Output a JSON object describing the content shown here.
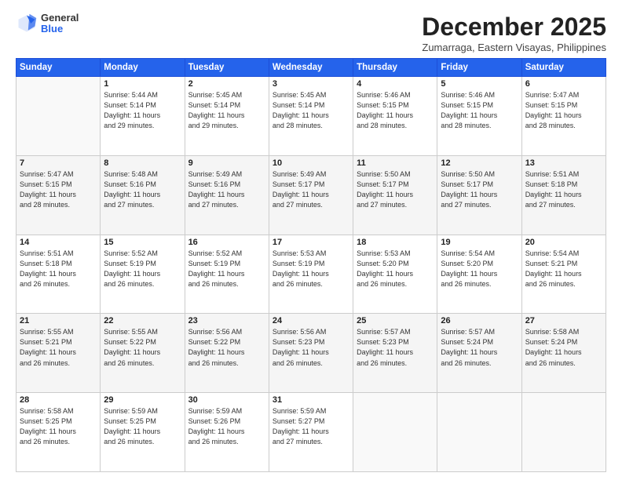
{
  "logo": {
    "general": "General",
    "blue": "Blue"
  },
  "header": {
    "month": "December 2025",
    "location": "Zumarraga, Eastern Visayas, Philippines"
  },
  "weekdays": [
    "Sunday",
    "Monday",
    "Tuesday",
    "Wednesday",
    "Thursday",
    "Friday",
    "Saturday"
  ],
  "weeks": [
    [
      {
        "day": "",
        "info": ""
      },
      {
        "day": "1",
        "info": "Sunrise: 5:44 AM\nSunset: 5:14 PM\nDaylight: 11 hours\nand 29 minutes."
      },
      {
        "day": "2",
        "info": "Sunrise: 5:45 AM\nSunset: 5:14 PM\nDaylight: 11 hours\nand 29 minutes."
      },
      {
        "day": "3",
        "info": "Sunrise: 5:45 AM\nSunset: 5:14 PM\nDaylight: 11 hours\nand 28 minutes."
      },
      {
        "day": "4",
        "info": "Sunrise: 5:46 AM\nSunset: 5:15 PM\nDaylight: 11 hours\nand 28 minutes."
      },
      {
        "day": "5",
        "info": "Sunrise: 5:46 AM\nSunset: 5:15 PM\nDaylight: 11 hours\nand 28 minutes."
      },
      {
        "day": "6",
        "info": "Sunrise: 5:47 AM\nSunset: 5:15 PM\nDaylight: 11 hours\nand 28 minutes."
      }
    ],
    [
      {
        "day": "7",
        "info": "Sunrise: 5:47 AM\nSunset: 5:15 PM\nDaylight: 11 hours\nand 28 minutes."
      },
      {
        "day": "8",
        "info": "Sunrise: 5:48 AM\nSunset: 5:16 PM\nDaylight: 11 hours\nand 27 minutes."
      },
      {
        "day": "9",
        "info": "Sunrise: 5:49 AM\nSunset: 5:16 PM\nDaylight: 11 hours\nand 27 minutes."
      },
      {
        "day": "10",
        "info": "Sunrise: 5:49 AM\nSunset: 5:17 PM\nDaylight: 11 hours\nand 27 minutes."
      },
      {
        "day": "11",
        "info": "Sunrise: 5:50 AM\nSunset: 5:17 PM\nDaylight: 11 hours\nand 27 minutes."
      },
      {
        "day": "12",
        "info": "Sunrise: 5:50 AM\nSunset: 5:17 PM\nDaylight: 11 hours\nand 27 minutes."
      },
      {
        "day": "13",
        "info": "Sunrise: 5:51 AM\nSunset: 5:18 PM\nDaylight: 11 hours\nand 27 minutes."
      }
    ],
    [
      {
        "day": "14",
        "info": "Sunrise: 5:51 AM\nSunset: 5:18 PM\nDaylight: 11 hours\nand 26 minutes."
      },
      {
        "day": "15",
        "info": "Sunrise: 5:52 AM\nSunset: 5:19 PM\nDaylight: 11 hours\nand 26 minutes."
      },
      {
        "day": "16",
        "info": "Sunrise: 5:52 AM\nSunset: 5:19 PM\nDaylight: 11 hours\nand 26 minutes."
      },
      {
        "day": "17",
        "info": "Sunrise: 5:53 AM\nSunset: 5:19 PM\nDaylight: 11 hours\nand 26 minutes."
      },
      {
        "day": "18",
        "info": "Sunrise: 5:53 AM\nSunset: 5:20 PM\nDaylight: 11 hours\nand 26 minutes."
      },
      {
        "day": "19",
        "info": "Sunrise: 5:54 AM\nSunset: 5:20 PM\nDaylight: 11 hours\nand 26 minutes."
      },
      {
        "day": "20",
        "info": "Sunrise: 5:54 AM\nSunset: 5:21 PM\nDaylight: 11 hours\nand 26 minutes."
      }
    ],
    [
      {
        "day": "21",
        "info": "Sunrise: 5:55 AM\nSunset: 5:21 PM\nDaylight: 11 hours\nand 26 minutes."
      },
      {
        "day": "22",
        "info": "Sunrise: 5:55 AM\nSunset: 5:22 PM\nDaylight: 11 hours\nand 26 minutes."
      },
      {
        "day": "23",
        "info": "Sunrise: 5:56 AM\nSunset: 5:22 PM\nDaylight: 11 hours\nand 26 minutes."
      },
      {
        "day": "24",
        "info": "Sunrise: 5:56 AM\nSunset: 5:23 PM\nDaylight: 11 hours\nand 26 minutes."
      },
      {
        "day": "25",
        "info": "Sunrise: 5:57 AM\nSunset: 5:23 PM\nDaylight: 11 hours\nand 26 minutes."
      },
      {
        "day": "26",
        "info": "Sunrise: 5:57 AM\nSunset: 5:24 PM\nDaylight: 11 hours\nand 26 minutes."
      },
      {
        "day": "27",
        "info": "Sunrise: 5:58 AM\nSunset: 5:24 PM\nDaylight: 11 hours\nand 26 minutes."
      }
    ],
    [
      {
        "day": "28",
        "info": "Sunrise: 5:58 AM\nSunset: 5:25 PM\nDaylight: 11 hours\nand 26 minutes."
      },
      {
        "day": "29",
        "info": "Sunrise: 5:59 AM\nSunset: 5:25 PM\nDaylight: 11 hours\nand 26 minutes."
      },
      {
        "day": "30",
        "info": "Sunrise: 5:59 AM\nSunset: 5:26 PM\nDaylight: 11 hours\nand 26 minutes."
      },
      {
        "day": "31",
        "info": "Sunrise: 5:59 AM\nSunset: 5:27 PM\nDaylight: 11 hours\nand 27 minutes."
      },
      {
        "day": "",
        "info": ""
      },
      {
        "day": "",
        "info": ""
      },
      {
        "day": "",
        "info": ""
      }
    ]
  ]
}
